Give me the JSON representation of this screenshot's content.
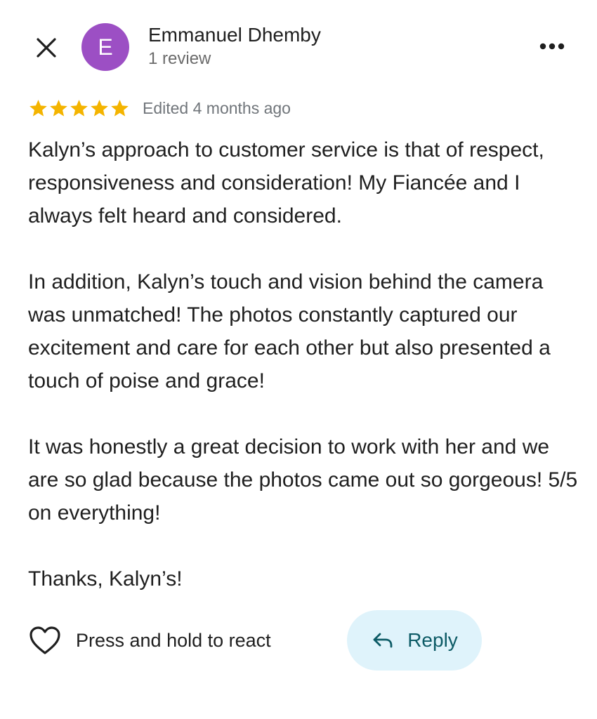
{
  "header": {
    "close_icon": "close-icon",
    "avatar_letter": "E",
    "author_name": "Emmanuel Dhemby",
    "review_count": "1 review",
    "more_icon": "more-horizontal-icon"
  },
  "rating": {
    "stars": 5,
    "max_stars": 5,
    "star_color": "#f4b400",
    "edited_text": "Edited 4 months ago"
  },
  "review": {
    "paragraphs": [
      "Kalyn’s approach to customer service is that of respect, responsiveness and consideration! My Fiancée and I always felt heard and considered.",
      "In addition, Kalyn’s touch and vision behind the camera was unmatched! The photos constantly captured our excitement and care for each other but also presented a touch of poise and grace!",
      "It was honestly a great decision to work with her and we are so glad because the photos came out so gorgeous! 5/5 on everything!",
      "Thanks, Kalyn’s!"
    ]
  },
  "actions": {
    "react_icon": "heart-outline-icon",
    "react_label": "Press and hold to react",
    "reply_icon": "reply-arrow-icon",
    "reply_label": "Reply"
  },
  "colors": {
    "avatar_bg": "#9c4fc4",
    "reply_bg": "#dff3fb",
    "reply_text": "#0d5b66"
  }
}
